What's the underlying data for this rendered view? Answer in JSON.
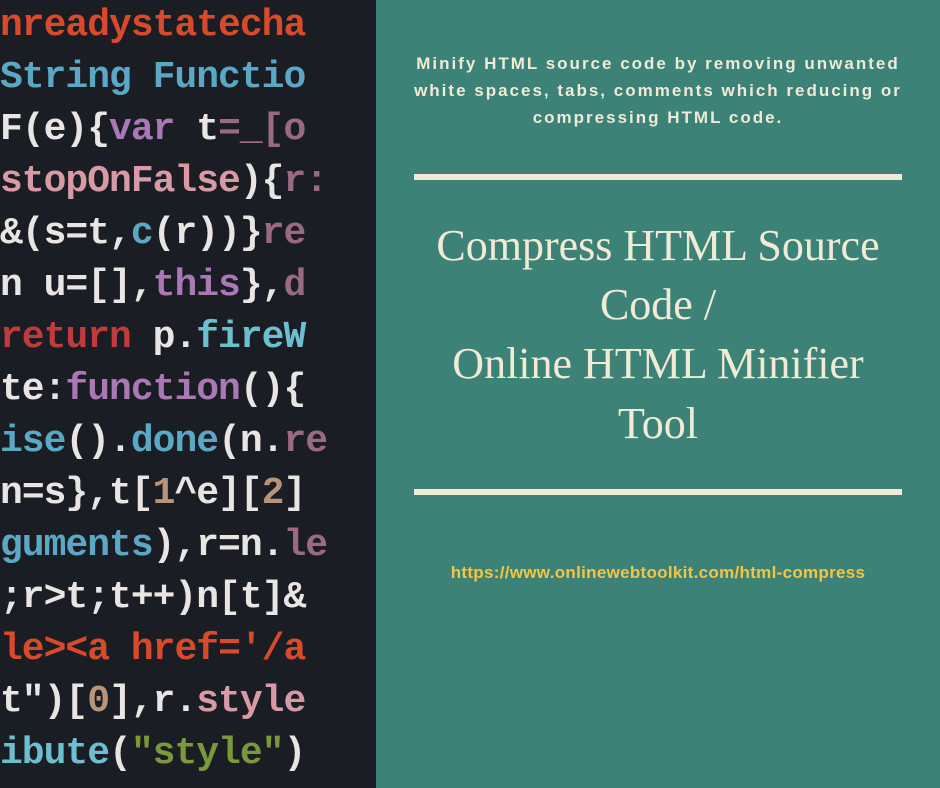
{
  "code": {
    "lines": [
      [
        {
          "t": "nreadystatecha",
          "c": "c-orange"
        }
      ],
      [
        {
          "t": "String Functio",
          "c": "c-blue"
        }
      ],
      [
        {
          "t": " F",
          "c": "c-white"
        },
        {
          "t": "(e){",
          "c": "c-white"
        },
        {
          "t": "var",
          "c": "c-purple"
        },
        {
          "t": " t",
          "c": "c-white"
        },
        {
          "t": "=_[o",
          "c": "c-plum"
        }
      ],
      [
        {
          "t": "stopOnFalse",
          "c": "c-pink"
        },
        {
          "t": "){",
          "c": "c-white"
        },
        {
          "t": "r:",
          "c": "c-plum"
        }
      ],
      [
        {
          "t": "&(",
          "c": "c-white"
        },
        {
          "t": "s",
          "c": "c-white"
        },
        {
          "t": "=t,",
          "c": "c-white"
        },
        {
          "t": "c",
          "c": "c-blue"
        },
        {
          "t": "(r))}",
          "c": "c-white"
        },
        {
          "t": "re",
          "c": "c-plum"
        }
      ],
      [
        {
          "t": "n ",
          "c": "c-white"
        },
        {
          "t": "u",
          "c": "c-white"
        },
        {
          "t": "=[],",
          "c": "c-white"
        },
        {
          "t": "this",
          "c": "c-purple"
        },
        {
          "t": "},",
          "c": "c-white"
        },
        {
          "t": "d",
          "c": "c-plum"
        }
      ],
      [
        {
          "t": "return",
          "c": "c-red"
        },
        {
          "t": " p.",
          "c": "c-white"
        },
        {
          "t": "fireW",
          "c": "c-teal"
        }
      ],
      [
        {
          "t": "te",
          "c": "c-white"
        },
        {
          "t": ":",
          "c": "c-white"
        },
        {
          "t": "function",
          "c": "c-purple"
        },
        {
          "t": "(){",
          "c": "c-white"
        }
      ],
      [
        {
          "t": "ise",
          "c": "c-blue"
        },
        {
          "t": "().",
          "c": "c-white"
        },
        {
          "t": "done",
          "c": "c-blue"
        },
        {
          "t": "(n.",
          "c": "c-white"
        },
        {
          "t": "re",
          "c": "c-plum"
        }
      ],
      [
        {
          "t": "n",
          "c": "c-white"
        },
        {
          "t": "=s},t[",
          "c": "c-white"
        },
        {
          "t": "1",
          "c": "c-tan"
        },
        {
          "t": "^e][",
          "c": "c-white"
        },
        {
          "t": "2",
          "c": "c-tan"
        },
        {
          "t": "]",
          "c": "c-white"
        }
      ],
      [
        {
          "t": "guments",
          "c": "c-blue"
        },
        {
          "t": "),r=n.",
          "c": "c-white"
        },
        {
          "t": "le",
          "c": "c-plum"
        }
      ],
      [
        {
          "t": ";r>t;t++)n[t]&",
          "c": "c-white"
        }
      ],
      [
        {
          "t": "le>",
          "c": "c-orange"
        },
        {
          "t": "<a ",
          "c": "c-orange"
        },
        {
          "t": "href",
          "c": "c-orange"
        },
        {
          "t": "='/a",
          "c": "c-orange"
        }
      ],
      [
        {
          "t": "t\")[",
          "c": "c-white"
        },
        {
          "t": "0",
          "c": "c-tan"
        },
        {
          "t": "],r.",
          "c": "c-white"
        },
        {
          "t": "style",
          "c": "c-pink"
        }
      ],
      [
        {
          "t": "ibute",
          "c": "c-teal"
        },
        {
          "t": "(",
          "c": "c-white"
        },
        {
          "t": "\"style\"",
          "c": "c-green"
        },
        {
          "t": ")",
          "c": "c-white"
        }
      ]
    ]
  },
  "panel": {
    "subtitle": "Minify HTML source code by removing unwanted white spaces, tabs, comments which reducing or compressing HTML code.",
    "title_line1": "Compress HTML Source Code /",
    "title_line2": "Online HTML Minifier Tool",
    "url": "https://www.onlinewebtoolkit.com/html-compress"
  }
}
